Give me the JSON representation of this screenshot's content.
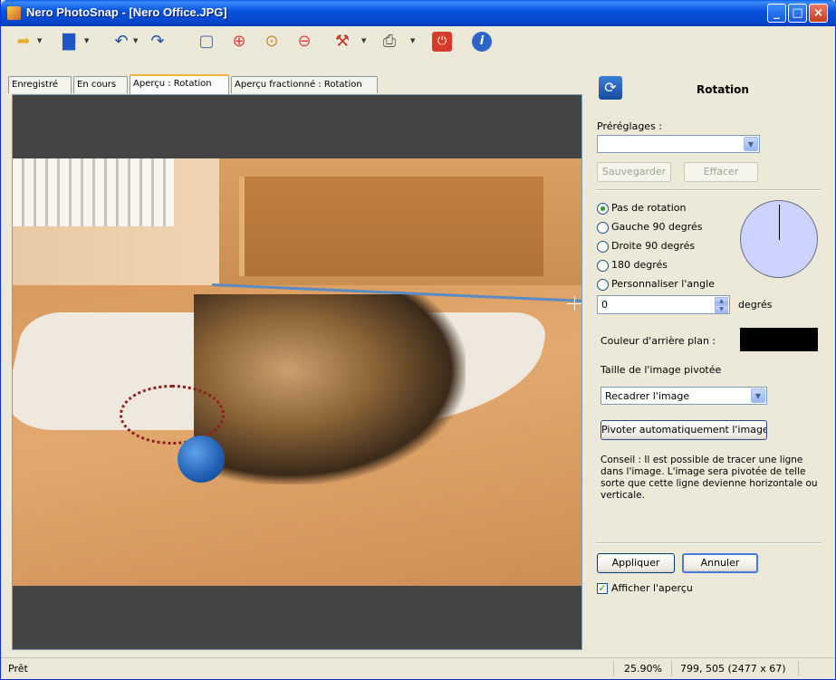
{
  "window": {
    "title": "Nero PhotoSnap - [Nero Office.JPG]"
  },
  "toolbar": {
    "icons": [
      "open-icon",
      "save-icon",
      "undo-icon",
      "redo-icon",
      "zoom-fit-icon",
      "zoom-in-icon",
      "zoom-actual-icon",
      "zoom-out-icon",
      "tools-icon",
      "print-icon",
      "exit-icon",
      "info-icon"
    ]
  },
  "tabs": [
    {
      "label": "Enregistré"
    },
    {
      "label": "En cours"
    },
    {
      "label": "Aperçu : Rotation"
    },
    {
      "label": "Aperçu fractionné : Rotation"
    }
  ],
  "panel": {
    "title": "Rotation",
    "presets_label": "Préréglages :",
    "presets_value": "",
    "save_label": "Sauvegarder",
    "delete_label": "Effacer",
    "rotation_options": [
      {
        "label": "Pas de rotation",
        "checked": true
      },
      {
        "label": "Gauche 90 degrés",
        "checked": false
      },
      {
        "label": "Droite 90 degrés",
        "checked": false
      },
      {
        "label": "180 degrés",
        "checked": false
      },
      {
        "label": "Personnaliser l'angle",
        "checked": false
      }
    ],
    "angle_value": "0",
    "angle_unit": "degrés",
    "bg_color_label": "Couleur d'arrière plan :",
    "bg_color": "#000000",
    "size_label": "Taille de l'image pivotée",
    "size_value": "Recadrer l'image",
    "auto_rotate_label": "Pivoter automatiquement l'image",
    "tip": "Conseil : Il est possible de tracer une ligne dans l'image. L'image sera pivotée de telle sorte que cette ligne devienne horizontale ou verticale.",
    "apply_label": "Appliquer",
    "cancel_label": "Annuler",
    "show_preview_label": "Afficher l'aperçu",
    "show_preview_checked": true
  },
  "status": {
    "text": "Prêt",
    "zoom": "25.90%",
    "coords": "799, 505 (2477 x 67)"
  },
  "colors": {
    "accent": "#0853e0",
    "guide_line": "#5a8bc2"
  }
}
